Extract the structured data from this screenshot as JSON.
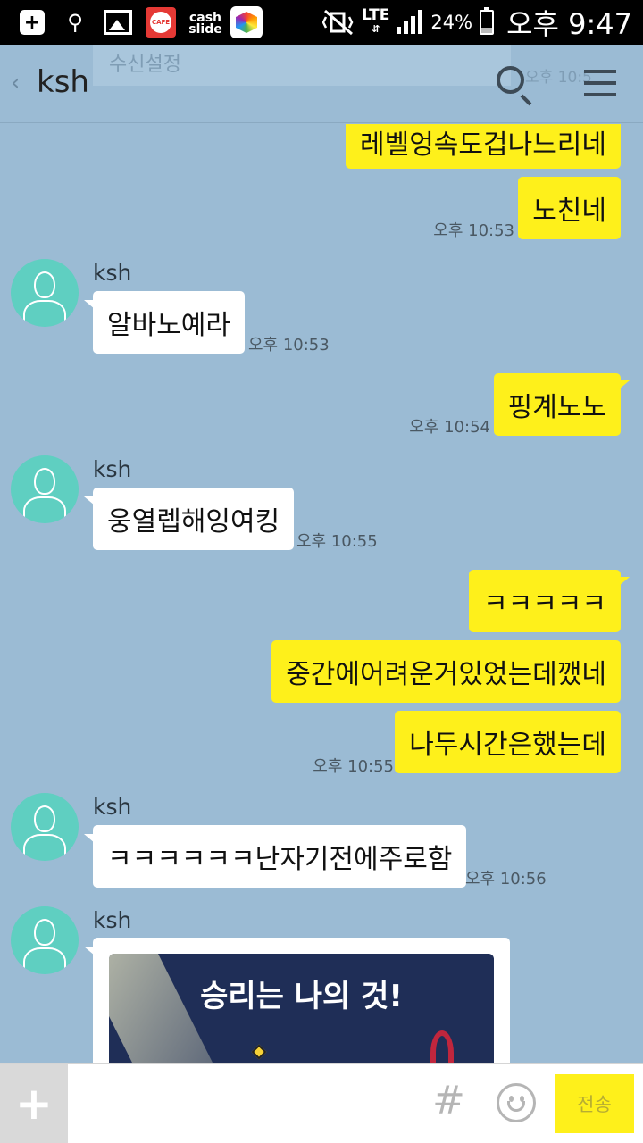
{
  "statusbar": {
    "cash_line1": "cash",
    "cash_line2": "slide",
    "cafe_label": "CAFE",
    "network": "LTE",
    "battery": "24%",
    "time": "오후 9:47"
  },
  "header": {
    "ghost_banner": "수신설정",
    "ghost_time": "오후 10:5",
    "title": "ksh",
    "back_glyph": "‹"
  },
  "messages": [
    {
      "text": "레벨엉속도겁나느리네"
    },
    {
      "text": "노친네",
      "time": "오후 10:53"
    },
    {
      "sender": "ksh",
      "text": "알바노예라",
      "time": "오후 10:53"
    },
    {
      "text": "핑계노노",
      "time": "오후 10:54"
    },
    {
      "sender": "ksh",
      "text": "웅열렙해잉여킹",
      "time": "오후 10:55"
    },
    {
      "text": "ㅋㅋㅋㅋㅋ"
    },
    {
      "text": "중간에어려운거있었는데깼네"
    },
    {
      "text": "나두시간은했는데",
      "time": "오후 10:55"
    },
    {
      "sender": "ksh",
      "text": "ㅋㅋㅋㅋㅋㅋ난자기전에주로함",
      "time": "오후 10:56"
    },
    {
      "sender": "ksh",
      "sticker_text": "승리는 나의 것!"
    }
  ],
  "input": {
    "placeholder": "",
    "hash": "#",
    "send_label": "전송",
    "plus": "+"
  },
  "colors": {
    "chat_bg": "#9bbbd4",
    "my_bubble": "#fef01b",
    "their_bubble": "#ffffff",
    "avatar": "#5fcfc1"
  }
}
